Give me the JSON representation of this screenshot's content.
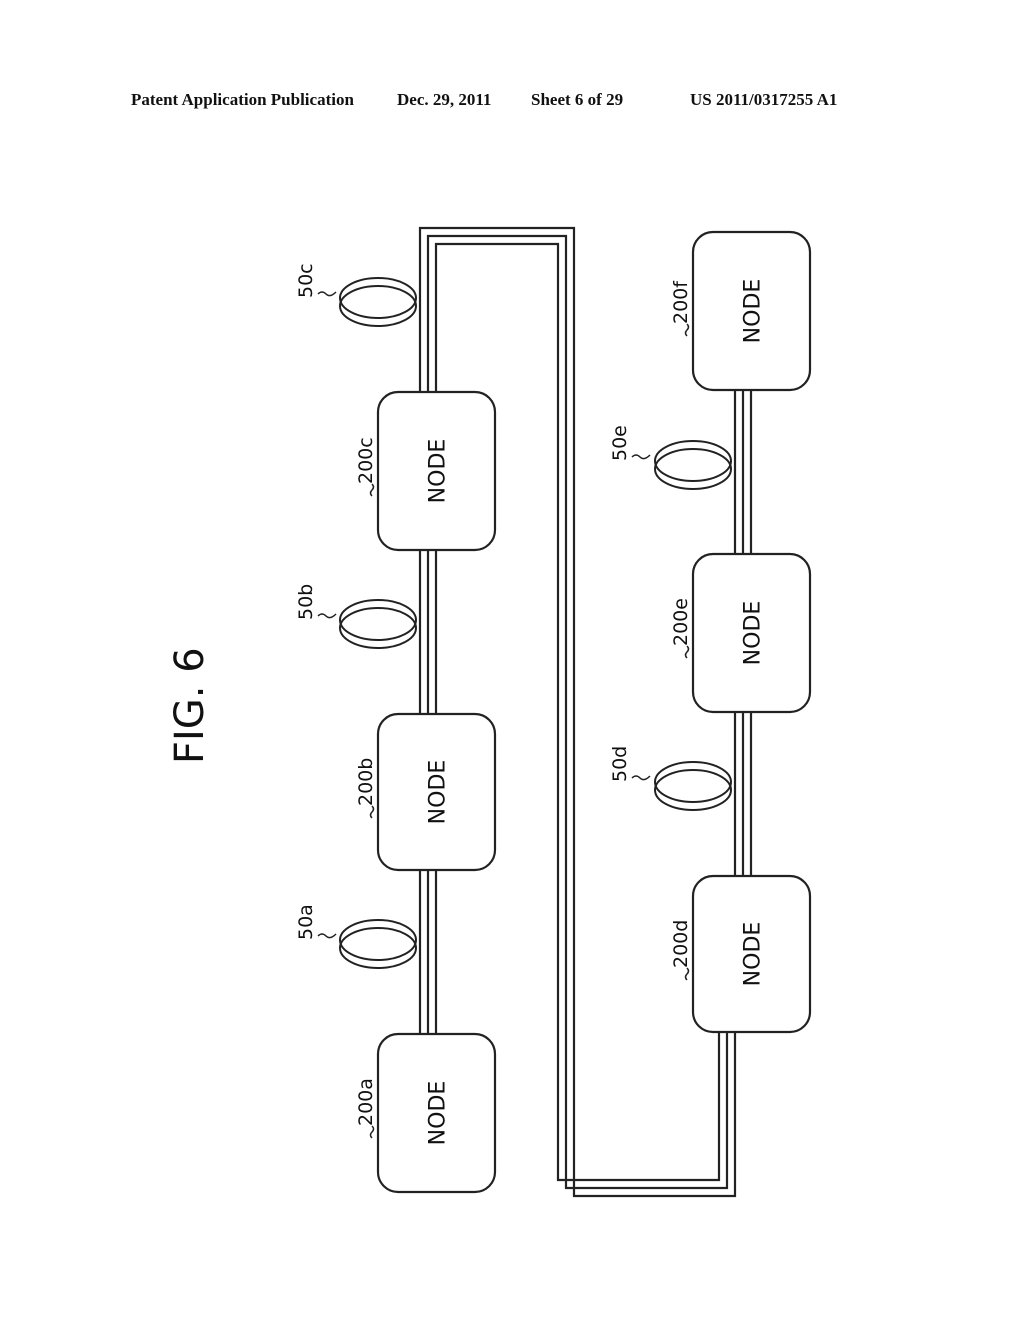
{
  "header": {
    "publication": "Patent Application Publication",
    "date": "Dec. 29, 2011",
    "sheet": "Sheet 6 of 29",
    "patent_number": "US 2011/0317255 A1"
  },
  "figure": {
    "title": "FIG. 6",
    "nodes": [
      {
        "ref": "200a",
        "label": "NODE"
      },
      {
        "ref": "200b",
        "label": "NODE"
      },
      {
        "ref": "200c",
        "label": "NODE"
      },
      {
        "ref": "200d",
        "label": "NODE"
      },
      {
        "ref": "200e",
        "label": "NODE"
      },
      {
        "ref": "200f",
        "label": "NODE"
      }
    ],
    "fibers": [
      {
        "ref": "50a"
      },
      {
        "ref": "50b"
      },
      {
        "ref": "50c"
      },
      {
        "ref": "50d"
      },
      {
        "ref": "50e"
      }
    ]
  }
}
